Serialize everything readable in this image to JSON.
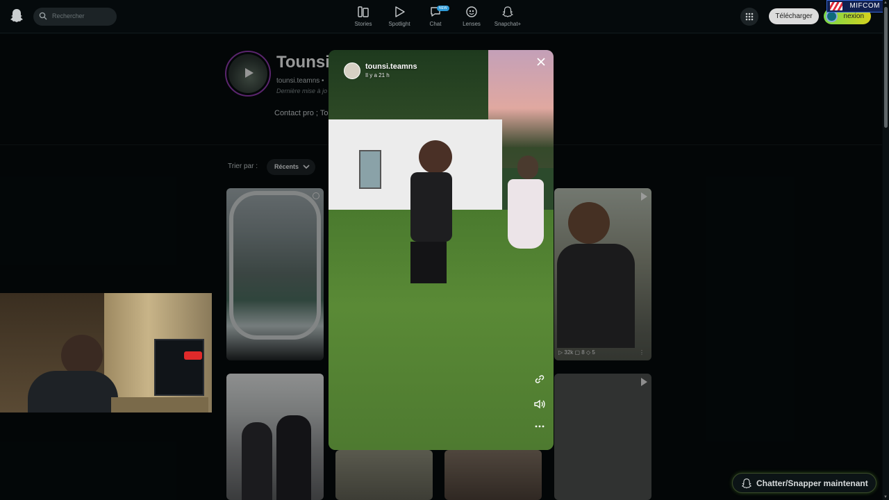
{
  "header": {
    "search_placeholder": "Rechercher",
    "nav": [
      {
        "label": "Stories",
        "icon": "stories-icon"
      },
      {
        "label": "Spotlight",
        "icon": "spotlight-play-icon"
      },
      {
        "label": "Chat",
        "icon": "chat-icon",
        "badge": "NEW"
      },
      {
        "label": "Lenses",
        "icon": "lenses-icon"
      },
      {
        "label": "Snapchat+",
        "icon": "snapchat-plus-icon"
      }
    ],
    "download_label": "Télécharger",
    "login_label": "nexion",
    "overlay_logo": "MIFCOM"
  },
  "profile": {
    "name": "Tounsi",
    "username": "tounsi.teamns",
    "separator": "•",
    "last_update": "Dernière mise à jo",
    "bio": "Contact pro ; To"
  },
  "sort": {
    "label": "Trier par :",
    "value": "Récents"
  },
  "tiles": [
    {
      "stats": ""
    },
    {
      "stats": "▷ 32k  ▢ 8  ◇ 5",
      "more": "⋮"
    }
  ],
  "modal": {
    "username": "tounsi.teamns",
    "time": "Il y a 21 h",
    "actions": [
      "link-icon",
      "volume-icon",
      "more-options-icon"
    ]
  },
  "cta": {
    "label": "Chatter/Snapper maintenant"
  },
  "colors": {
    "background": "#050a0c",
    "story_ring": "#8a3aa8",
    "accent_gradient_start": "#7ad84a",
    "accent_gradient_end": "#d6d21e"
  }
}
